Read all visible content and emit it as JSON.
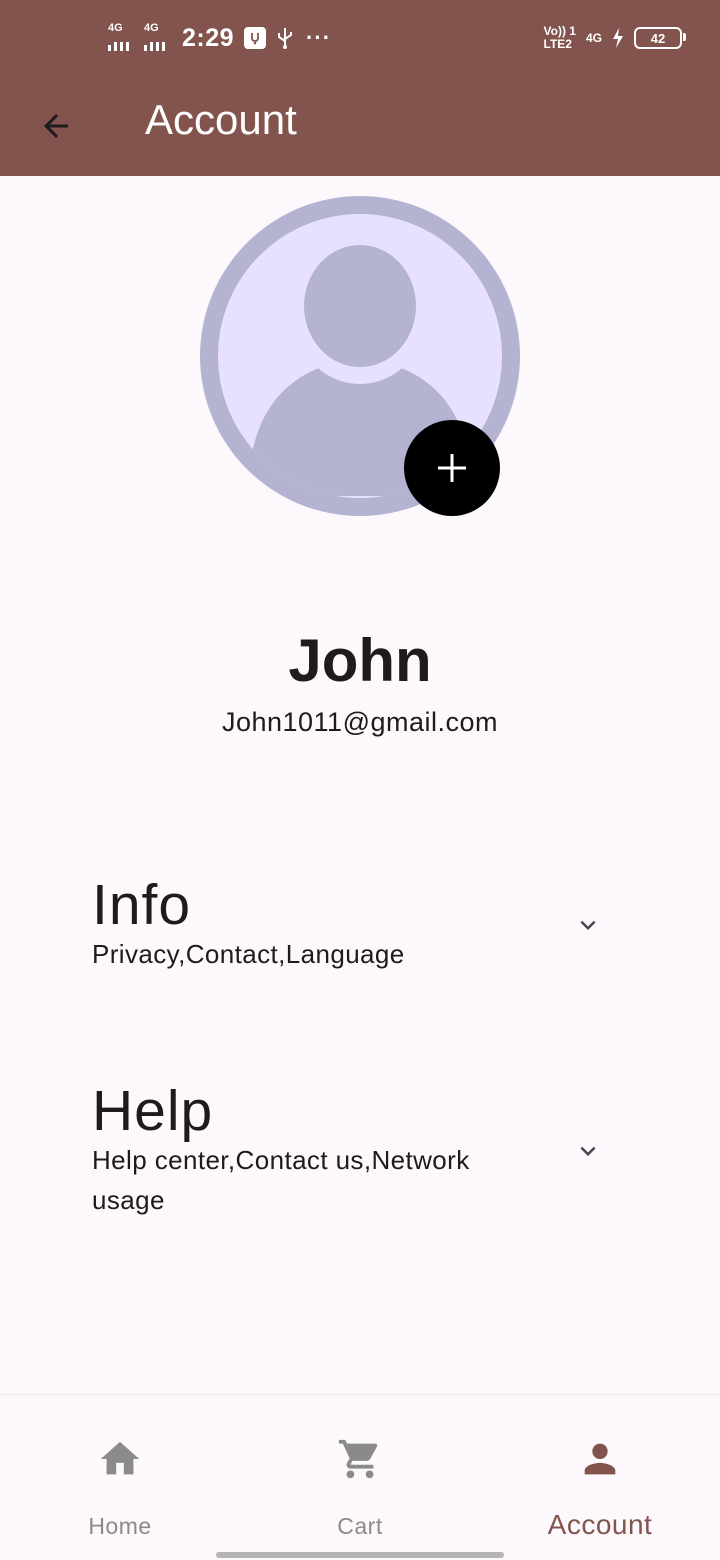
{
  "status_bar": {
    "sim1_label": "4G",
    "sim2_label": "4G",
    "time": "2:29",
    "overflow": "···",
    "volte_top": "Vo)) 1",
    "volte_bottom": "LTE2",
    "net_label": "4G",
    "battery_level": "42",
    "icons": [
      "signal-icon",
      "usb-debug-icon",
      "usb-icon",
      "charging-icon",
      "battery-icon"
    ]
  },
  "app_bar": {
    "title": "Account",
    "back_icon": "arrow-back-icon",
    "background": "#83544e"
  },
  "profile": {
    "name": "John",
    "email": "John1011@gmail.com",
    "avatar_icon": "person-avatar-icon",
    "add_icon": "plus-icon"
  },
  "sections": [
    {
      "title": "Info",
      "subtitle": "Privacy,Contact,Language",
      "icon": "chevron-down-icon"
    },
    {
      "title": "Help",
      "subtitle": "Help center,Contact us,Network usage",
      "icon": "chevron-down-icon"
    }
  ],
  "bottom_nav": {
    "items": [
      {
        "label": "Home",
        "icon": "home-icon",
        "active": false
      },
      {
        "label": "Cart",
        "icon": "cart-icon",
        "active": false
      },
      {
        "label": "Account",
        "icon": "person-icon",
        "active": true
      }
    ],
    "active_color": "#83544e",
    "inactive_color": "#8a8a8a"
  }
}
